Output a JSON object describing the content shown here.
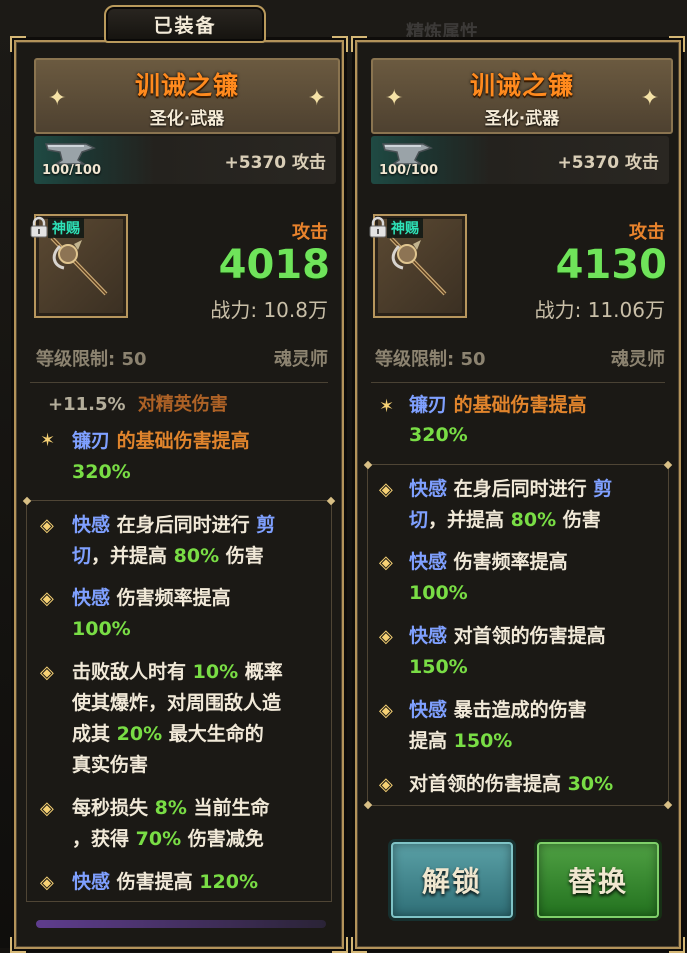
{
  "tab": {
    "label": "已装备"
  },
  "left": {
    "name": "训诫之镰",
    "subtitle": "圣化·武器",
    "forge_count": "100/100",
    "forge_bonus": "+5370 攻击",
    "divine_tag": "神赐",
    "atk_label": "攻击",
    "atk_value": "4018",
    "power": "战力: 10.8万",
    "level_req": "等级限制: 50",
    "class": "魂灵师",
    "faded_stat": {
      "value": "+11.5%",
      "label": "对精英伤害"
    },
    "base_line": {
      "kw": "镰刃",
      "text": "的基础伤害提高",
      "value": "320%"
    },
    "passives": [
      {
        "kw": "快感",
        "text1": "在身后同时进行",
        "kw2": "剪",
        "line2_kw": "切",
        "line2_a": "，并提高",
        "line2_val": "80%",
        "line2_b": "伤害"
      },
      {
        "kw": "快感",
        "text1": "伤害频率提高",
        "line2_val": "100%"
      },
      {
        "l1": "击败敌人时有",
        "v1": "10%",
        "l1b": "概率",
        "l2": "使其爆炸，对周围敌人造",
        "l3": "成其",
        "v3": "20%",
        "l3b": "最大生命的",
        "l4": "真实伤害"
      },
      {
        "l1": "每秒损失",
        "v1": "8%",
        "l1b": "当前生命",
        "l2a": "，获得",
        "v2": "70%",
        "l2b": "伤害减免"
      },
      {
        "kw": "快感",
        "text1": "伤害提高",
        "val": "120%"
      }
    ]
  },
  "right": {
    "top_faded": "精炼属性",
    "name": "训诫之镰",
    "subtitle": "圣化·武器",
    "forge_count": "100/100",
    "forge_bonus": "+5370 攻击",
    "divine_tag": "神赐",
    "atk_label": "攻击",
    "atk_value": "4130",
    "power": "战力: 11.06万",
    "level_req": "等级限制: 50",
    "class": "魂灵师",
    "base_line": {
      "kw": "镰刃",
      "text": "的基础伤害提高",
      "value": "320%"
    },
    "passives": [
      {
        "kw": "快感",
        "text1": "在身后同时进行",
        "kw2": "剪",
        "line2_kw": "切",
        "line2_a": "，并提高",
        "line2_val": "80%",
        "line2_b": "伤害"
      },
      {
        "kw": "快感",
        "text1": "伤害频率提高",
        "line2_val": "100%"
      },
      {
        "kw": "快感",
        "text1": "对首领的伤害提高",
        "line2_val": "150%"
      },
      {
        "kw": "快感",
        "text1": "暴击造成的伤害",
        "line2_a": "提高",
        "line2_val": "150%"
      },
      {
        "l1": "对首领的伤害提高",
        "v1": "30%"
      }
    ],
    "buttons": {
      "unlock": "解锁",
      "replace": "替换"
    }
  },
  "colors": {
    "gold_border": "#b3935a",
    "name_orange": "#ff8a1e",
    "value_green": "#6fe45a",
    "keyword_blue": "#7fa0ff",
    "button_teal": "#3b8a91",
    "button_green": "#349a2d"
  }
}
